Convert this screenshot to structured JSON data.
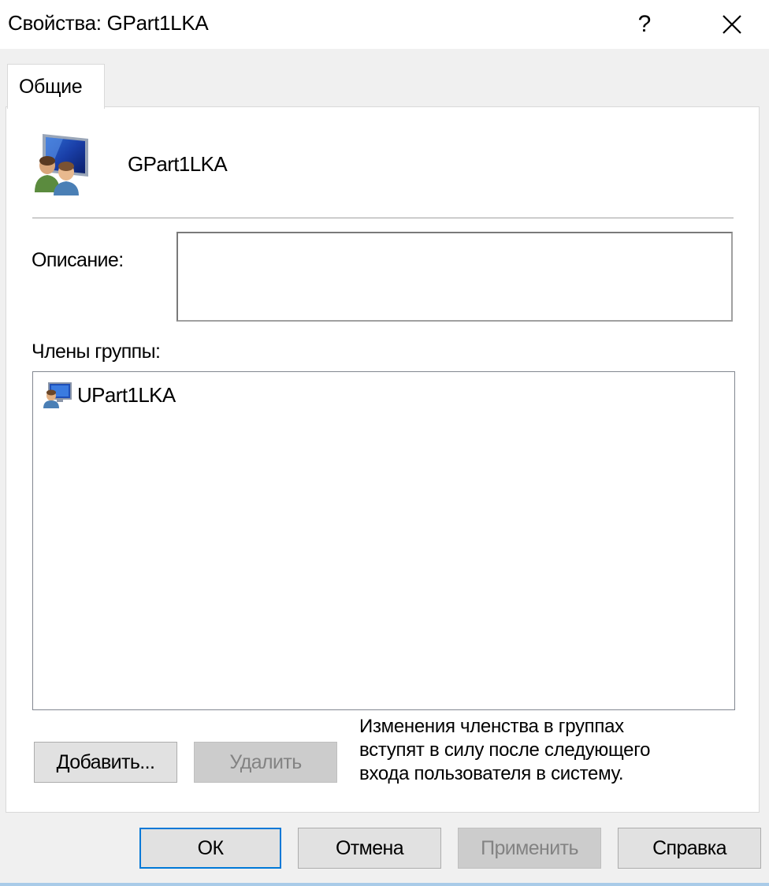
{
  "window": {
    "title": "Свойства: GPart1LKA",
    "help_label": "?",
    "close_icon": "close-icon"
  },
  "tabs": [
    {
      "label": "Общие",
      "selected": true
    }
  ],
  "group": {
    "name": "GPart1LKA",
    "icon": "group-icon"
  },
  "description": {
    "label": "Описание:",
    "value": ""
  },
  "members": {
    "label": "Члены группы:",
    "items": [
      {
        "name": "UPart1LKA",
        "icon": "user-icon"
      }
    ]
  },
  "buttons": {
    "add": "Добавить...",
    "remove": "Удалить"
  },
  "note_lines": [
    "Изменения членства в группах",
    "вступят в силу после следующего",
    "входа пользователя в систему."
  ],
  "footer": {
    "ok": "ОК",
    "cancel": "Отмена",
    "apply": "Применить",
    "help": "Справка"
  },
  "colors": {
    "accent": "#0078d7",
    "dialog_bg": "#f0f0f0",
    "panel_bg": "#ffffff"
  }
}
